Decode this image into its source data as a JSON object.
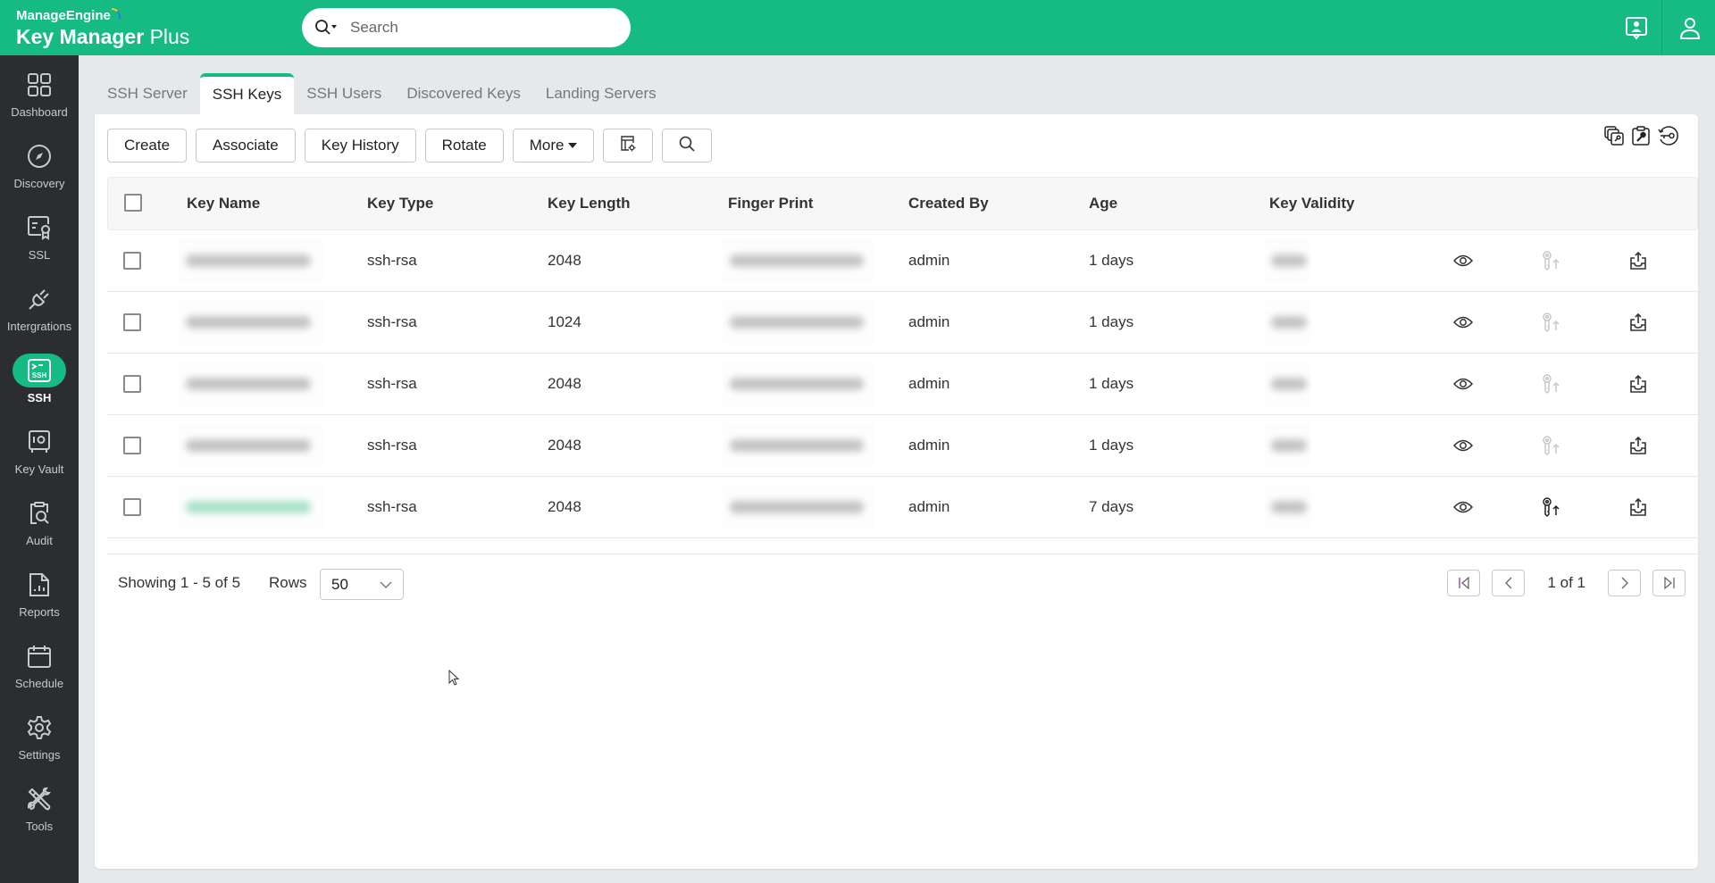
{
  "app": {
    "vendor": "ManageEngine",
    "product_bold": "Key Manager",
    "product_light": "Plus"
  },
  "search": {
    "placeholder": "Search",
    "value": ""
  },
  "topbar_icons": [
    "user-support-icon",
    "user-profile-icon"
  ],
  "sidebar": {
    "items": [
      {
        "label": "Dashboard",
        "icon": "dashboard-icon",
        "active": false
      },
      {
        "label": "Discovery",
        "icon": "compass-icon",
        "active": false
      },
      {
        "label": "SSL",
        "icon": "certificate-icon",
        "active": false
      },
      {
        "label": "Intergrations",
        "icon": "plug-icon",
        "active": false
      },
      {
        "label": "SSH",
        "icon": "ssh-terminal-icon",
        "active": true
      },
      {
        "label": "Key Vault",
        "icon": "vault-icon",
        "active": false
      },
      {
        "label": "Audit",
        "icon": "audit-clipboard-icon",
        "active": false
      },
      {
        "label": "Reports",
        "icon": "report-icon",
        "active": false
      },
      {
        "label": "Schedule",
        "icon": "calendar-icon",
        "active": false
      },
      {
        "label": "Settings",
        "icon": "gear-icon",
        "active": false
      },
      {
        "label": "Tools",
        "icon": "tools-icon",
        "active": false
      }
    ]
  },
  "tabs": [
    {
      "label": "SSH Server",
      "active": false
    },
    {
      "label": "SSH Keys",
      "active": true
    },
    {
      "label": "SSH Users",
      "active": false
    },
    {
      "label": "Discovered Keys",
      "active": false
    },
    {
      "label": "Landing Servers",
      "active": false
    }
  ],
  "toolbar": {
    "create": "Create",
    "associate": "Associate",
    "key_history": "Key History",
    "rotate": "Rotate",
    "more": "More"
  },
  "panel_icons": [
    "copy-key-icon",
    "key-clipboard-icon",
    "key-history-icon"
  ],
  "table": {
    "columns": [
      "Key Name",
      "Key Type",
      "Key Length",
      "Finger Print",
      "Created By",
      "Age",
      "Key Validity"
    ],
    "rows": [
      {
        "key_name": "(redacted)",
        "key_type": "ssh-rsa",
        "key_length": "2048",
        "finger_print": "(redacted)",
        "created_by": "admin",
        "age": "1 days",
        "key_validity": "(redacted)",
        "deploy_enabled": false
      },
      {
        "key_name": "(redacted)",
        "key_type": "ssh-rsa",
        "key_length": "1024",
        "finger_print": "(redacted)",
        "created_by": "admin",
        "age": "1 days",
        "key_validity": "(redacted)",
        "deploy_enabled": false
      },
      {
        "key_name": "(redacted)",
        "key_type": "ssh-rsa",
        "key_length": "2048",
        "finger_print": "(redacted)",
        "created_by": "admin",
        "age": "1 days",
        "key_validity": "(redacted)",
        "deploy_enabled": false
      },
      {
        "key_name": "(redacted)",
        "key_type": "ssh-rsa",
        "key_length": "2048",
        "finger_print": "(redacted)",
        "created_by": "admin",
        "age": "1 days",
        "key_validity": "(redacted)",
        "deploy_enabled": false
      },
      {
        "key_name": "(redacted)",
        "key_type": "ssh-rsa",
        "key_length": "2048",
        "finger_print": "(redacted)",
        "created_by": "admin",
        "age": "7 days",
        "key_validity": "(redacted)",
        "deploy_enabled": true
      }
    ]
  },
  "pagination": {
    "showing": "Showing 1 - 5 of 5",
    "rows_label": "Rows",
    "rows_value": "50",
    "page_text": "1 of 1"
  },
  "colors": {
    "brand_green": "#15bb83",
    "sidebar_bg": "#2b2d30",
    "page_bg": "#e6e9ec"
  }
}
